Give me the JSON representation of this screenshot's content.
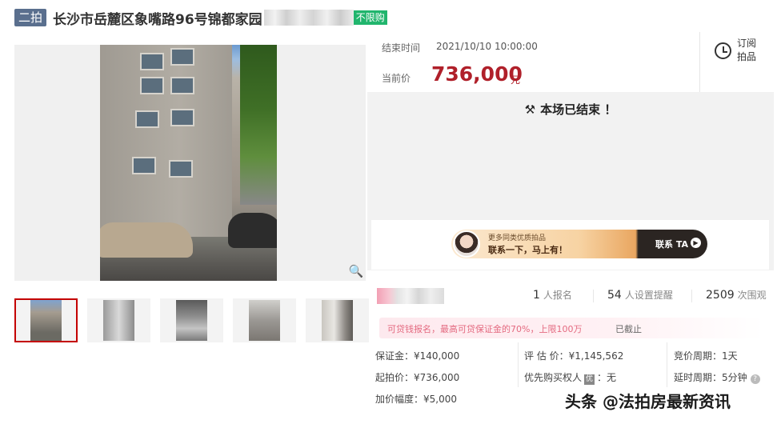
{
  "header": {
    "round": "二拍",
    "title": "长沙市岳麓区象嘴路96号锦都家园",
    "limit_badge": "不限购"
  },
  "auction": {
    "end_label": "结束时间",
    "end_time": "2021/10/10 10:00:00",
    "price_label": "当前价",
    "price": "736,000",
    "price_unit": "元",
    "subscribe": "订阅拍品",
    "ended_message": "本场已结束 ！"
  },
  "promo": {
    "line1": "更多同类优质拍品",
    "line2": "联系一下，马上有！",
    "cta": "联系 TA"
  },
  "stats": {
    "signups_count": "1",
    "signups_label": "人报名",
    "reminders_count": "54",
    "reminders_label": "人设置提醒",
    "views_count": "2509",
    "views_label": "次围观"
  },
  "deposit_note": {
    "text": "可贷钱报名，最高可贷保证金的70%，上限100万",
    "status": "已截止"
  },
  "details": {
    "deposit": "保证金：¥140,000",
    "start_price": "起拍价：¥736,000",
    "increment": "加价幅度：¥5,000",
    "appraisal": "评 估 价：¥1,145,562",
    "priority_label": "优先购买权人",
    "priority_badge": "优",
    "priority_value": "：无",
    "cycle": "竞价周期：1天",
    "delay": "延时周期：5分钟"
  },
  "watermark": "头条 @法拍房最新资讯",
  "colors": {
    "price_red": "#b0202a",
    "round_badge": "#5a6f8e",
    "limit_green": "#21b56d",
    "thumb_active_border": "#c40000"
  }
}
